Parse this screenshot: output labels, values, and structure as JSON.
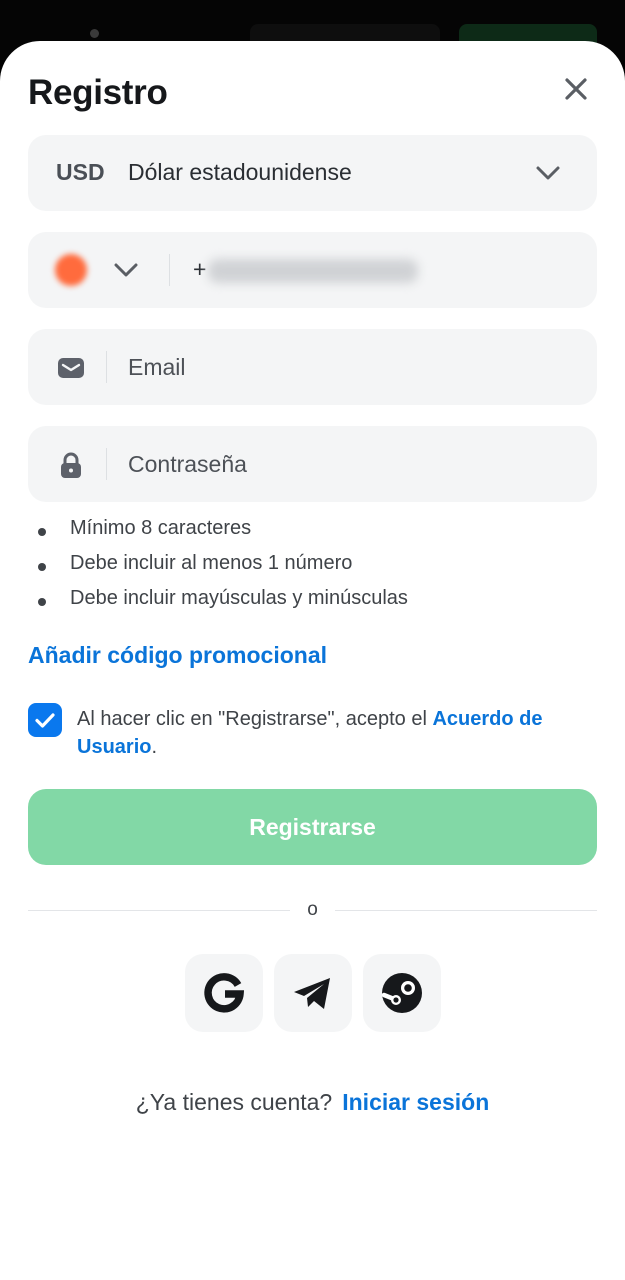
{
  "header": {
    "title": "Registro"
  },
  "currency": {
    "code": "USD",
    "name": "Dólar estadounidense"
  },
  "phone": {
    "prefix": "+"
  },
  "email": {
    "placeholder": "Email"
  },
  "password": {
    "placeholder": "Contraseña"
  },
  "password_rules": [
    "Mínimo 8 caracteres",
    "Debe incluir al menos 1 número",
    "Debe incluir mayúsculas y minúsculas"
  ],
  "promo_link": "Añadir código promocional",
  "agreement": {
    "checked": true,
    "text_before": "Al hacer clic en \"Registrarse\", acepto el ",
    "link": "Acuerdo de Usuario",
    "text_after": "."
  },
  "submit_label": "Registrarse",
  "divider_text": "o",
  "social_buttons": [
    "google-icon",
    "telegram-icon",
    "steam-icon"
  ],
  "login": {
    "prompt": "¿Ya tienes cuenta?",
    "link": "Iniciar sesión"
  },
  "colors": {
    "accent_blue": "#0a74d9",
    "submit_green": "#82d8a6",
    "field_bg": "#f4f5f6",
    "checkbox_blue": "#0a78ee"
  }
}
